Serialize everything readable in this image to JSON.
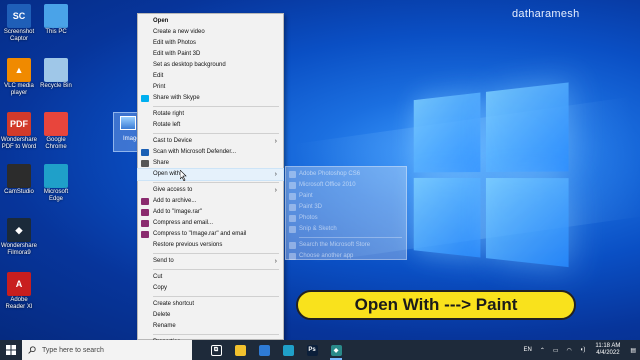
{
  "watermark": "datharamesh",
  "desktop_icons": [
    {
      "label": "Screenshot Captor",
      "icon": "screenshot-captor-icon",
      "glyph": "SC",
      "color": "#1f5fb8"
    },
    {
      "label": "This PC",
      "icon": "this-pc-icon",
      "glyph": "",
      "color": "#4aa3e8"
    },
    {
      "label": "VLC media player",
      "icon": "vlc-icon",
      "glyph": "▲",
      "color": "#f08a00"
    },
    {
      "label": "Recycle Bin",
      "icon": "recycle-bin-icon",
      "glyph": "",
      "color": "#9fc7e8"
    },
    {
      "label": "Wondershare PDF to Word",
      "icon": "pdf-to-word-icon",
      "glyph": "PDF",
      "color": "#d23a2a"
    },
    {
      "label": "Google Chrome",
      "icon": "chrome-icon",
      "glyph": "",
      "color": "#e8453c"
    },
    {
      "label": "CamStudio",
      "icon": "camstudio-icon",
      "glyph": "",
      "color": "#2c2c2c"
    },
    {
      "label": "Microsoft Edge",
      "icon": "edge-icon",
      "glyph": "",
      "color": "#1fa0c9"
    },
    {
      "label": "Wondershare Filmora9",
      "icon": "filmora-icon",
      "glyph": "◆",
      "color": "#1b2a3a"
    },
    {
      "label": "Adobe Reader XI",
      "icon": "adobe-reader-icon",
      "glyph": "A",
      "color": "#c81e1e"
    }
  ],
  "selected_file_label": "Image",
  "context_menu": {
    "items": [
      {
        "label": "Open",
        "bold": true,
        "icon": ""
      },
      {
        "label": "Create a new video",
        "icon": ""
      },
      {
        "label": "Edit with Photos",
        "icon": ""
      },
      {
        "label": "Edit with Paint 3D",
        "icon": ""
      },
      {
        "label": "Set as desktop background",
        "icon": ""
      },
      {
        "label": "Edit",
        "icon": ""
      },
      {
        "label": "Print",
        "icon": ""
      },
      {
        "label": "Share with Skype",
        "icon": "skype-icon",
        "color": "#00aff0"
      },
      {
        "sep": true
      },
      {
        "label": "Rotate right",
        "icon": ""
      },
      {
        "label": "Rotate left",
        "icon": ""
      },
      {
        "sep": true
      },
      {
        "label": "Cast to Device",
        "icon": "",
        "submenu": true
      },
      {
        "label": "Scan with Microsoft Defender...",
        "icon": "defender-icon",
        "color": "#1a5fb4"
      },
      {
        "label": "Share",
        "icon": "share-icon",
        "color": "#555555"
      },
      {
        "label": "Open with",
        "icon": "",
        "submenu": true,
        "highlight": true
      },
      {
        "sep": true
      },
      {
        "label": "Give access to",
        "icon": "",
        "submenu": true
      },
      {
        "label": "Add to archive...",
        "icon": "winrar-icon",
        "color": "#8a2b6e"
      },
      {
        "label": "Add to \"Image.rar\"",
        "icon": "winrar-icon",
        "color": "#8a2b6e"
      },
      {
        "label": "Compress and email...",
        "icon": "winrar-icon",
        "color": "#8a2b6e"
      },
      {
        "label": "Compress to \"Image.rar\" and email",
        "icon": "winrar-icon",
        "color": "#8a2b6e"
      },
      {
        "label": "Restore previous versions",
        "icon": ""
      },
      {
        "sep": true
      },
      {
        "label": "Send to",
        "icon": "",
        "submenu": true
      },
      {
        "sep": true
      },
      {
        "label": "Cut",
        "icon": ""
      },
      {
        "label": "Copy",
        "icon": ""
      },
      {
        "sep": true
      },
      {
        "label": "Create shortcut",
        "icon": ""
      },
      {
        "label": "Delete",
        "icon": ""
      },
      {
        "label": "Rename",
        "icon": ""
      },
      {
        "sep": true
      },
      {
        "label": "Properties",
        "icon": ""
      }
    ]
  },
  "open_with_submenu": {
    "items": [
      {
        "label": "Adobe Photoshop CS6"
      },
      {
        "label": "Microsoft Office 2010"
      },
      {
        "label": "Paint"
      },
      {
        "label": "Paint 3D"
      },
      {
        "label": "Photos"
      },
      {
        "label": "Snip & Sketch"
      },
      {
        "sep": true
      },
      {
        "label": "Search the Microsoft Store"
      },
      {
        "label": "Choose another app"
      }
    ]
  },
  "banner": "Open With ---> Paint",
  "taskbar": {
    "search_placeholder": "Type here to search",
    "apps": [
      {
        "name": "task-view-icon",
        "glyph": "⧉",
        "color": "#1e2a3a"
      },
      {
        "name": "file-explorer-icon",
        "glyph": "",
        "color": "#f2c12e"
      },
      {
        "name": "store-icon",
        "glyph": "",
        "color": "#2e7bd6"
      },
      {
        "name": "edge-taskbar-icon",
        "glyph": "",
        "color": "#1fa0c9"
      },
      {
        "name": "photoshop-icon",
        "glyph": "Ps",
        "color": "#0b1f3a"
      },
      {
        "name": "filmora-taskbar-icon",
        "glyph": "◆",
        "color": "#2a8a8a",
        "active": true
      }
    ],
    "language": "EN",
    "time": "11:18 AM",
    "date": "4/4/2022"
  }
}
